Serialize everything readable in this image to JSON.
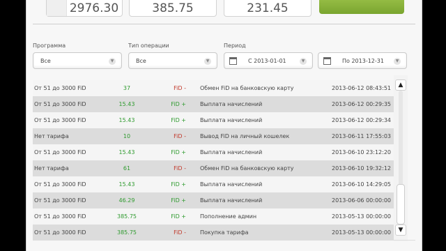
{
  "stats": {
    "box1": "2976.30",
    "box2": "385.75",
    "box3": "231.45"
  },
  "filters": {
    "program_label": "Программа",
    "program_value": "Все",
    "optype_label": "Тип операции",
    "optype_value": "Все",
    "period_label": "Период",
    "date_from": "С 2013-01-01",
    "date_to": "По 2013-12-31"
  },
  "rows": [
    {
      "tariff": "От 51 до 3000 FiD",
      "amount": "37",
      "currency": "FiD",
      "sign": "-",
      "desc": "Обмен FiD на банковскую карту",
      "date": "2013-06-12 08:43:51",
      "alt": false
    },
    {
      "tariff": "От 51 до 3000 FiD",
      "amount": "15.43",
      "currency": "FiD",
      "sign": "+",
      "desc": "Выплата начислений",
      "date": "2013-06-12 00:29:35",
      "alt": true
    },
    {
      "tariff": "От 51 до 3000 FiD",
      "amount": "15.43",
      "currency": "FiD",
      "sign": "+",
      "desc": "Выплата начислений",
      "date": "2013-06-12 00:29:34",
      "alt": false
    },
    {
      "tariff": "Нет тарифа",
      "amount": "10",
      "currency": "FiD",
      "sign": "-",
      "desc": "Вывод FiD на личный кошелек",
      "date": "2013-06-11 17:55:03",
      "alt": true
    },
    {
      "tariff": "От 51 до 3000 FiD",
      "amount": "15.43",
      "currency": "FiD",
      "sign": "+",
      "desc": "Выплата начислений",
      "date": "2013-06-10 23:12:20",
      "alt": false
    },
    {
      "tariff": "Нет тарифа",
      "amount": "61",
      "currency": "FiD",
      "sign": "-",
      "desc": "Обмен FiD на банковскую карту",
      "date": "2013-06-10 19:32:12",
      "alt": true
    },
    {
      "tariff": "От 51 до 3000 FiD",
      "amount": "15.43",
      "currency": "FiD",
      "sign": "+",
      "desc": "Выплата начислений",
      "date": "2013-06-10 14:29:05",
      "alt": false
    },
    {
      "tariff": "От 51 до 3000 FiD",
      "amount": "46.29",
      "currency": "FiD",
      "sign": "+",
      "desc": "Выплата начислений",
      "date": "2013-06-06 00:00:00",
      "alt": true
    },
    {
      "tariff": "От 51 до 3000 FiD",
      "amount": "385.75",
      "currency": "FiD",
      "sign": "+",
      "desc": "Пополнение админ",
      "date": "2013-05-13 00:00:00",
      "alt": false
    },
    {
      "tariff": "От 51 до 3000 FiD",
      "amount": "385.75",
      "currency": "FiD",
      "sign": "-",
      "desc": "Покупка тарифа",
      "date": "2013-05-13 00:00:00",
      "alt": true
    }
  ],
  "colors": {
    "positive": "#2e9a2e",
    "negative": "#c0392b",
    "accent": "#8ab63c"
  },
  "icons": {
    "scroll_up": "arrow-up-icon",
    "scroll_down": "arrow-down-icon",
    "calendar": "calendar-icon",
    "dropdown": "chevron-down-icon"
  }
}
